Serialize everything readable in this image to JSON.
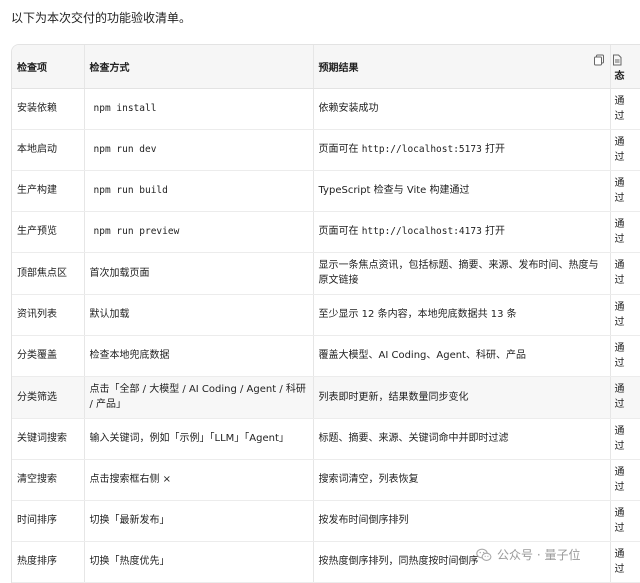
{
  "intro": "以下为本次交付的功能验收清单。",
  "table": {
    "headers": {
      "item": "检查项",
      "method": "检查方式",
      "expected": "预期结果",
      "status": "态"
    },
    "rows": [
      {
        "item": "安装依赖",
        "method": "npm install",
        "expected": "依赖安装成功",
        "status": "通过"
      },
      {
        "item": "本地启动",
        "method": "npm run dev",
        "expected_prefix": "页面可在",
        "expected_url": "http://localhost:5173",
        "expected_suffix": "打开",
        "status": "通过"
      },
      {
        "item": "生产构建",
        "method": "npm run build",
        "expected": "TypeScript 检查与 Vite 构建通过",
        "status": "通过"
      },
      {
        "item": "生产预览",
        "method": "npm run preview",
        "expected_prefix": "页面可在",
        "expected_url": "http://localhost:4173",
        "expected_suffix": "打开",
        "status": "通过"
      },
      {
        "item": "顶部焦点区",
        "method": "首次加载页面",
        "expected": "显示一条焦点资讯，包括标题、摘要、来源、发布时间、热度与原文链接",
        "status": "通过"
      },
      {
        "item": "资讯列表",
        "method": "默认加载",
        "expected": "至少显示 12 条内容，本地兜底数据共 13 条",
        "status": "通过"
      },
      {
        "item": "分类覆盖",
        "method": "检查本地兜底数据",
        "expected": "覆盖大模型、AI Coding、Agent、科研、产品",
        "status": "通过"
      },
      {
        "item": "分类筛选",
        "method": "点击「全部 / 大模型 / AI Coding / Agent / 科研 / 产品」",
        "expected": "列表即时更新，结果数量同步变化",
        "status": "通过"
      },
      {
        "item": "关键词搜索",
        "method": "输入关键词，例如「示例」「LLM」「Agent」",
        "expected": "标题、摘要、来源、关键词命中并即时过滤",
        "status": "通过"
      },
      {
        "item": "清空搜索",
        "method": "点击搜索框右侧 ×",
        "expected": "搜索词清空，列表恢复",
        "status": "通过"
      },
      {
        "item": "时间排序",
        "method": "切换「最新发布」",
        "expected": "按发布时间倒序排列",
        "status": "通过"
      },
      {
        "item": "热度排序",
        "method": "切换「热度优先」",
        "expected": "按热度倒序排列，同热度按时间倒序",
        "status": "通过"
      }
    ]
  },
  "watermark": {
    "text": "公众号 · 量子位",
    "logo": "wechat-logo"
  },
  "icons": {
    "copy": "copy-icon",
    "file": "file-icon"
  }
}
